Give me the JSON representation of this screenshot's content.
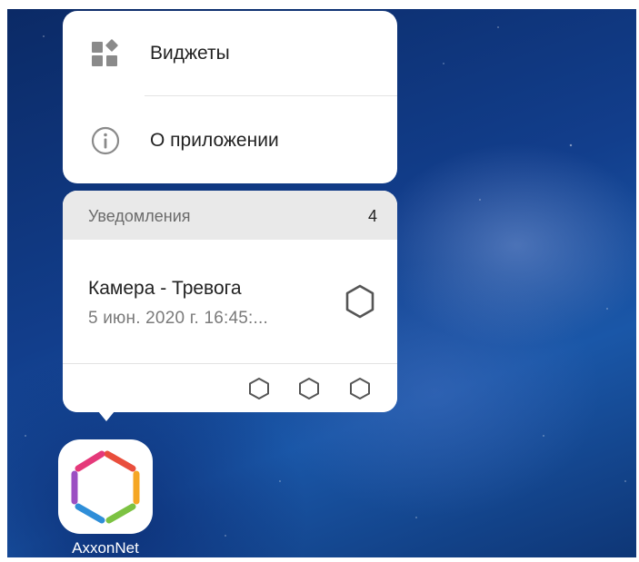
{
  "menu": {
    "items": [
      {
        "label": "Виджеты",
        "icon": "widgets-icon"
      },
      {
        "label": "О приложении",
        "icon": "info-icon"
      }
    ]
  },
  "notifications": {
    "title": "Уведомления",
    "count": "4",
    "item": {
      "title": "Камера - Тревога",
      "subtitle": "5 июн. 2020 г. 16:45:..."
    }
  },
  "app": {
    "label": "AxxonNet",
    "icon": "axxonnet-logo-icon"
  },
  "colors": {
    "panel": "#ffffff",
    "header": "#e9e9e9",
    "text": "#222222",
    "muted": "#7a7a7a",
    "logo": [
      "#e94e3c",
      "#f5a623",
      "#7cc242",
      "#2f8ed8",
      "#9b4fc2",
      "#e5397a"
    ]
  }
}
